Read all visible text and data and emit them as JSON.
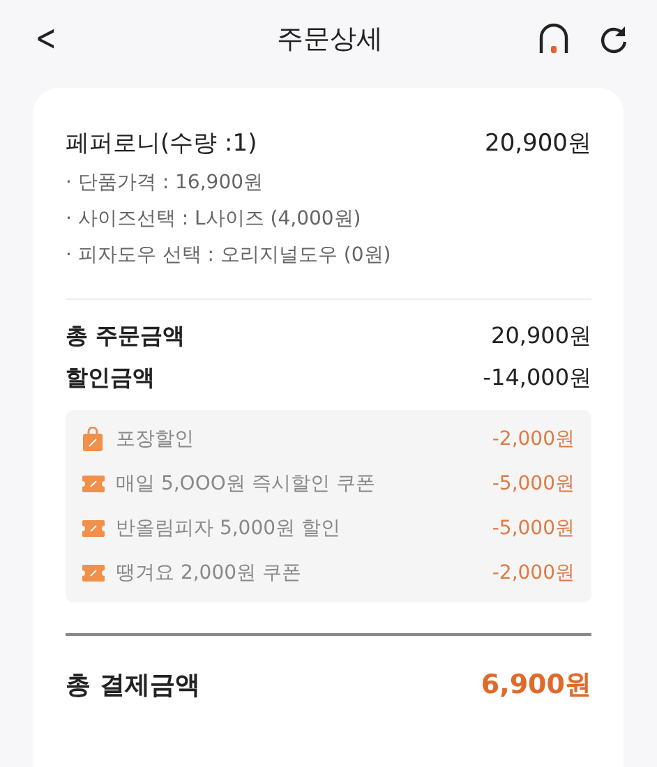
{
  "header": {
    "back": "<",
    "title": "주문상세"
  },
  "item": {
    "name": "페퍼로니(수량 :1)",
    "price": "20,900원",
    "options": [
      {
        "text": "· 단품가격 : 16,900원"
      },
      {
        "text": "· 사이즈선택 : L사이즈 (4,000원)"
      },
      {
        "text": "· 피자도우 선택 : 오리지널도우 (0원)"
      }
    ]
  },
  "totals": [
    {
      "label": "총 주문금액",
      "value": "20,900원"
    },
    {
      "label": "할인금액",
      "value": "-14,000원"
    }
  ],
  "discounts": [
    {
      "kind": "bag",
      "label": "포장할인",
      "amount": "-2,000원"
    },
    {
      "kind": "coupon",
      "label": "매일 5,OOO원 즉시할인 쿠폰",
      "amount": "-5,000원"
    },
    {
      "kind": "coupon",
      "label": "반올림피자 5,000원 할인",
      "amount": "-5,000원"
    },
    {
      "kind": "coupon",
      "label": "땡겨요 2,000원 쿠폰",
      "amount": "-2,000원"
    }
  ],
  "payment": {
    "label": "총 결제금액",
    "value": "6,900원"
  }
}
